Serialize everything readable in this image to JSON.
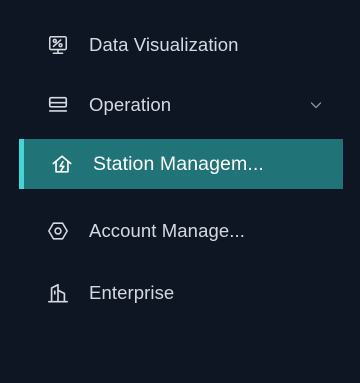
{
  "sidebar": {
    "items": [
      {
        "label": "Data Visualization",
        "icon": "monitor-chart-icon",
        "active": false
      },
      {
        "label": "Operation",
        "icon": "server-icon",
        "active": false,
        "expandable": true
      },
      {
        "label": "Station Managem...",
        "icon": "station-home-icon",
        "active": true
      },
      {
        "label": "Account Manage...",
        "icon": "hexagon-settings-icon",
        "active": false
      },
      {
        "label": "Enterprise",
        "icon": "enterprise-building-icon",
        "active": false
      }
    ]
  },
  "colors": {
    "background": "#0e1523",
    "active_background": "#207478",
    "active_accent": "#43d6d6",
    "text": "#d5dae2",
    "active_text": "#ffffff"
  }
}
